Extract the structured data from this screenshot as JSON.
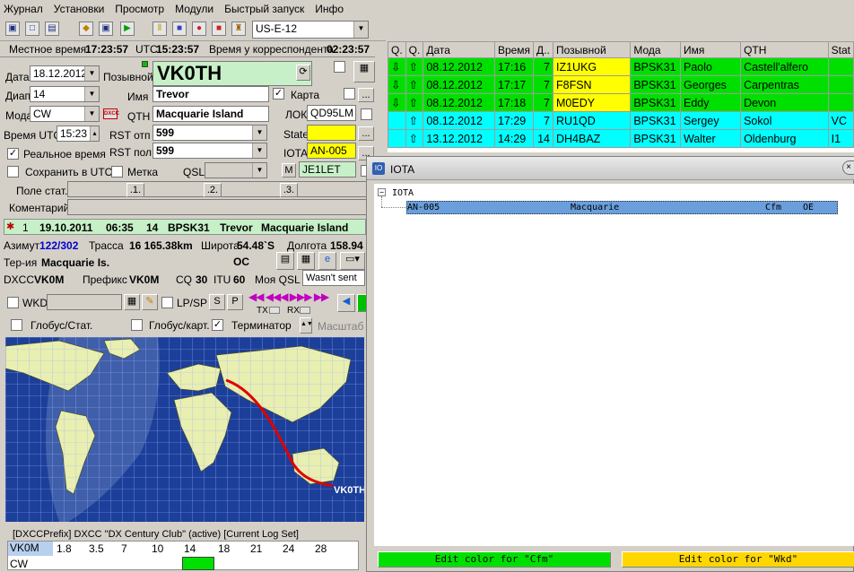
{
  "menu": [
    "Журнал",
    "Установки",
    "Просмотр",
    "Модули",
    "Быстрый запуск",
    "Инфо"
  ],
  "toolbar": {
    "contest": "US-E-12"
  },
  "times": {
    "local_label": "Местное время",
    "local": "17:23:57",
    "utc_label": "UTC",
    "utc": "15:23:57",
    "corr_label": "Время у корреспондента",
    "corr": "02:23:57"
  },
  "form": {
    "date_label": "Дата",
    "date": "18.12.2012",
    "callsign_label": "Позывной",
    "callsign": "VK0TH",
    "band_label": "Диап",
    "band": "14",
    "name_label": "Имя",
    "name": "Trevor",
    "map_label": "Карта",
    "mode_label": "Мода",
    "mode": "CW",
    "dxcc_icon": "DXCC",
    "qth_label": "QTH",
    "qth": "Macquarie Island",
    "loc_label": "ЛОК",
    "loc": "QD95LM",
    "time_label": "Время UTC",
    "time": "15:23",
    "rst_sent_label": "RST отп",
    "rst_sent": "599",
    "state_label": "State",
    "realtime_label": "Реальное время",
    "rst_rcvd_label": "RST пол",
    "rst_rcvd": "599",
    "iota_label": "IOTA",
    "iota": "AN-005",
    "save_utc_label": "Сохранить в UTC",
    "mark_label": "Метка",
    "qsl_label": "QSL",
    "m_label": "M",
    "manager": "JE1LET",
    "field_stat_label": "Поле стат.",
    "btn1": ".1.",
    "btn2": ".2.",
    "btn3": ".3.",
    "comment_label": "Коментарий"
  },
  "prev_qso": {
    "n": "1",
    "date": "19.10.2011",
    "time": "06:35",
    "band": "14",
    "mode": "BPSK31",
    "name": "Trevor",
    "qth": "Macquarie Island"
  },
  "info": {
    "az_label": "Азимут",
    "az": "122/302",
    "path_label": "Трасса",
    "path": "16 165.38km",
    "lat_label": "Широта",
    "lat": "54.48`S",
    "lon_label": "Долгота",
    "lon": "158.94",
    "terr_label": "Тер-ия",
    "terr": "Macquarie Is.",
    "cont": "OC",
    "dxcc_label": "DXCC",
    "dxcc": "VK0M",
    "prefix_label": "Префикс",
    "prefix": "VK0M",
    "cq_label": "CQ",
    "cq": "30",
    "itu_label": "ITU",
    "itu": "60",
    "myqsl_label": "Моя QSL",
    "myqsl": "Wasn't sent"
  },
  "ctrl": {
    "wkd": "WKD",
    "lpsp": "LP/SP",
    "s": "S",
    "p": "P",
    "tx": "TX",
    "rx": "RX",
    "globe_stat": "Глобус/Стат.",
    "globe_map": "Глобус/карт.",
    "terminator": "Терминатор",
    "scale": "Масштаб"
  },
  "map": {
    "label": "VK0TH"
  },
  "dxcc_table": {
    "title": "[DXCCPrefix] DXCC \"DX Century Club\" (active) [Current Log Set]",
    "prefix": "VK0M",
    "bands": [
      "1.8",
      "3.5",
      "7",
      "10",
      "14",
      "18",
      "21",
      "24",
      "28"
    ],
    "mode": "CW"
  },
  "log": {
    "columns": [
      "Q.",
      "Q.",
      "Дата",
      "Время",
      "Д..",
      "Позывной",
      "Мода",
      "Имя",
      "QTH",
      "Stat"
    ],
    "rows": [
      {
        "date": "08.12.2012",
        "time": "17:16",
        "band": "7",
        "call": "IZ1UKG",
        "mode": "BPSK31",
        "name": "Paolo",
        "qth": "Castell'alfero",
        "extra": "",
        "color": "g"
      },
      {
        "date": "08.12.2012",
        "time": "17:17",
        "band": "7",
        "call": "F8FSN",
        "mode": "BPSK31",
        "name": "Georges",
        "qth": "Carpentras",
        "extra": "",
        "color": "g"
      },
      {
        "date": "08.12.2012",
        "time": "17:18",
        "band": "7",
        "call": "M0EDY",
        "mode": "BPSK31",
        "name": "Eddy",
        "qth": "Devon",
        "extra": "",
        "color": "g"
      },
      {
        "date": "08.12.2012",
        "time": "17:29",
        "band": "7",
        "call": "RU1QD",
        "mode": "BPSK31",
        "name": "Sergey",
        "qth": "Sokol",
        "extra": "VC",
        "color": "c"
      },
      {
        "date": "13.12.2012",
        "time": "14:29",
        "band": "14",
        "call": "DH4BAZ",
        "mode": "BPSK31",
        "name": "Walter",
        "qth": "Oldenburg",
        "extra": "I1",
        "color": "c"
      }
    ]
  },
  "iota": {
    "title": "IOTA",
    "root": "IOTA",
    "code": "AN-005",
    "name": "Macquarie",
    "status": "Cfm",
    "cont": "OE",
    "btn_cfm": "Edit color for \"Cfm\"",
    "btn_wkd": "Edit color for \"Wkd\""
  },
  "colors": {
    "cfm": "#00e000",
    "wkd": "#ffd700",
    "ocean": "#1c3f9a",
    "land": "#e8efb0",
    "path": "#e00000"
  }
}
